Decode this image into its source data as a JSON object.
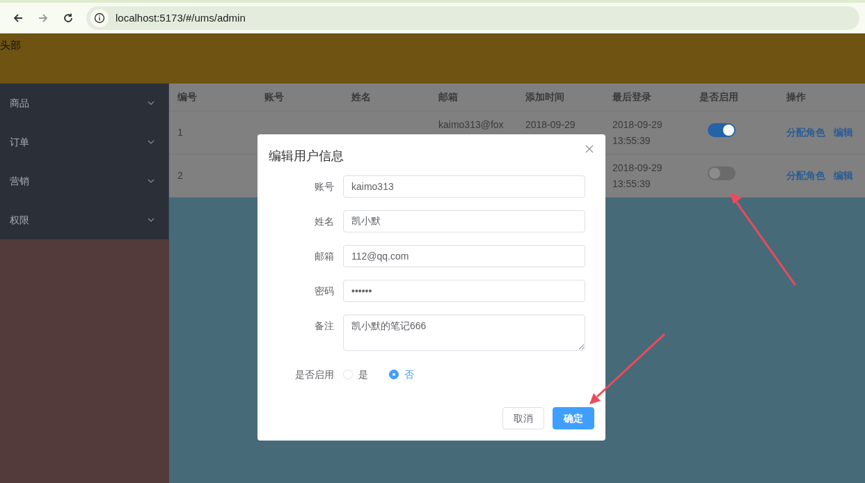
{
  "browser": {
    "url": "localhost:5173/#/ums/admin"
  },
  "header": {
    "title": "头部"
  },
  "sidebar": {
    "items": [
      {
        "label": "商品"
      },
      {
        "label": "订单"
      },
      {
        "label": "营销"
      },
      {
        "label": "权限"
      }
    ]
  },
  "table": {
    "columns": [
      "编号",
      "账号",
      "姓名",
      "邮箱",
      "添加时间",
      "最后登录",
      "是否启用",
      "操作"
    ],
    "rows": [
      {
        "id": "1",
        "email": "kaimo313@fox",
        "created": "2018-09-29",
        "last_login": [
          "2018-09-29",
          "13:55:39"
        ],
        "enabled": true,
        "actions": [
          "分配角色",
          "编辑"
        ]
      },
      {
        "id": "2",
        "last_login": [
          "2018-09-29",
          "13:55:39"
        ],
        "enabled": false,
        "actions": [
          "分配角色",
          "编辑"
        ]
      }
    ]
  },
  "dialog": {
    "title": "编辑用户信息",
    "fields": [
      {
        "label": "账号",
        "kind": "text",
        "value": "kaimo313"
      },
      {
        "label": "姓名",
        "kind": "text",
        "value": "凯小默"
      },
      {
        "label": "邮箱",
        "kind": "text",
        "value": "112@qq.com"
      },
      {
        "label": "密码",
        "kind": "password",
        "value": "••••••"
      },
      {
        "label": "备注",
        "kind": "textarea",
        "value": "凯小默的笔记666"
      },
      {
        "label": "是否启用",
        "kind": "radio",
        "options": [
          {
            "label": "是",
            "selected": false
          },
          {
            "label": "否",
            "selected": true
          }
        ]
      }
    ],
    "buttons": [
      {
        "label": "取消",
        "kind": "default"
      },
      {
        "label": "确定",
        "kind": "primary"
      }
    ]
  }
}
